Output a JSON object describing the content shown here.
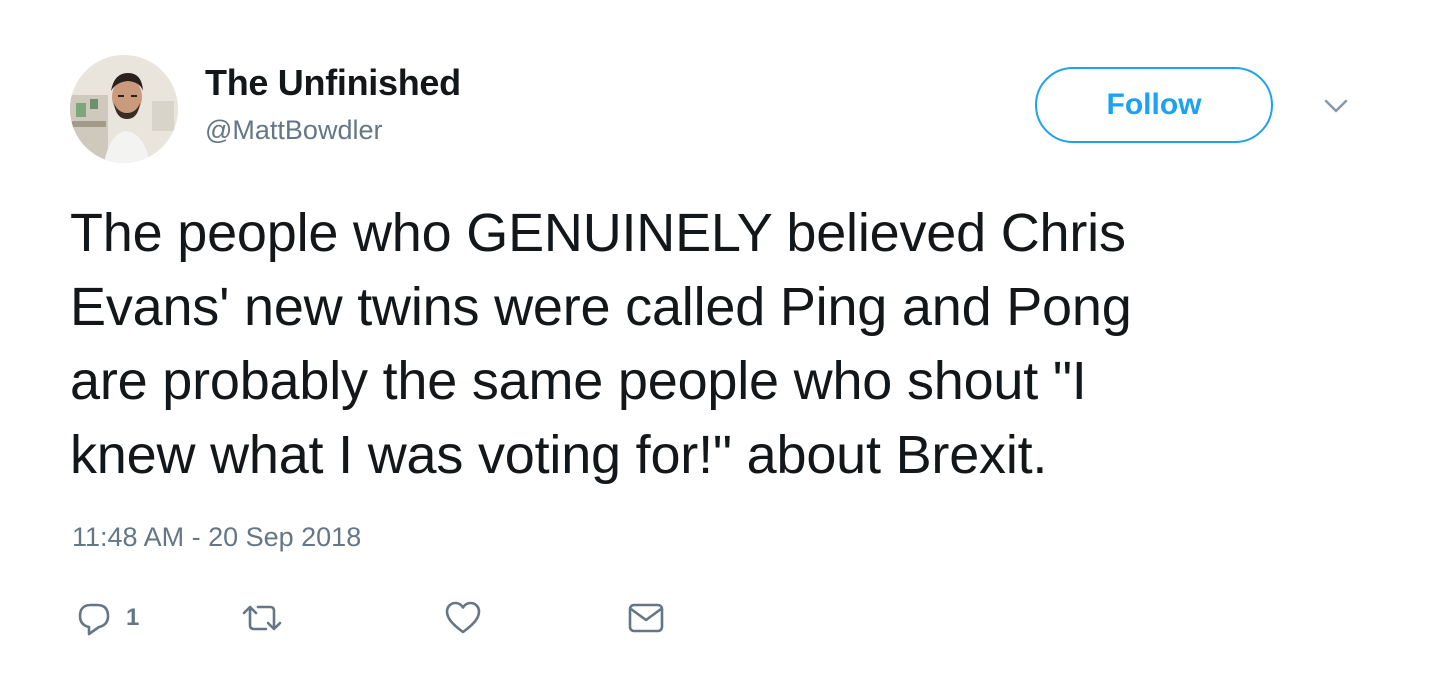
{
  "tweet": {
    "author": {
      "display_name": "The Unfinished",
      "handle": "@MattBowdler",
      "avatar_icon": "profile-photo"
    },
    "follow_label": "Follow",
    "text_lines": [
      "The people who GENUINELY believed Chris",
      "Evans' new twins were called Ping and Pong",
      "are probably the same people who shout \"I",
      "knew what I was voting for!\" about Brexit."
    ],
    "timestamp": "11:48 AM - 20 Sep 2018",
    "actions": {
      "reply_icon": "reply-icon",
      "reply_count": "1",
      "retweet_icon": "retweet-icon",
      "like_icon": "heart-icon",
      "dm_icon": "envelope-icon",
      "menu_icon": "chevron-down-icon"
    }
  },
  "colors": {
    "accent": "#1da1f2",
    "text": "#14171a",
    "secondary": "#657786"
  }
}
